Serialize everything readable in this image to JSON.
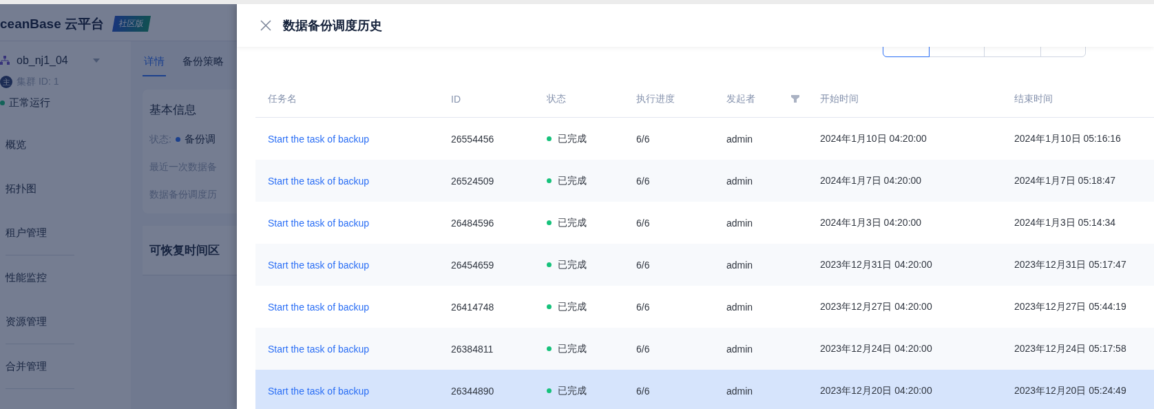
{
  "app": {
    "logo": "ceanBase 云平台",
    "edition_badge": "社区版",
    "cluster": {
      "name": "ob_nj1_04",
      "role_badge": "主",
      "id_label": "集群 ID: 1",
      "status": "正常运行"
    },
    "nav_groups": [
      {
        "items": [
          "概览",
          "拓扑图",
          "租户管理"
        ]
      },
      {
        "items": [
          "性能监控",
          "资源管理"
        ]
      },
      {
        "items": [
          "合并管理"
        ]
      }
    ],
    "tabs": [
      {
        "label": "详情",
        "selected": true
      },
      {
        "label": "备份策略",
        "selected": false
      }
    ],
    "basic_info": {
      "title": "基本信息",
      "status_label": "状态:",
      "status_value": "备份调",
      "rows": [
        "最近一次数据备",
        "数据备份调度历"
      ]
    },
    "recovery_card": {
      "title": "可恢复时间区"
    }
  },
  "drawer": {
    "title": "数据备份调度历史",
    "filters": [
      {
        "selected": true
      },
      {
        "selected": false
      },
      {
        "selected": false
      },
      {
        "selected": false
      }
    ],
    "columns": [
      {
        "label": "任务名"
      },
      {
        "label": "ID"
      },
      {
        "label": "状态"
      },
      {
        "label": "执行进度"
      },
      {
        "label": "发起者",
        "filterable": true
      },
      {
        "label": "开始时间"
      },
      {
        "label": "结束时间"
      }
    ],
    "rows": [
      {
        "task": "Start the task of backup",
        "id": "26554456",
        "status": "已完成",
        "progress": "6/6",
        "initiator": "admin",
        "start": "2024年1月10日 04:20:00",
        "end": "2024年1月10日 05:16:16",
        "selected": false
      },
      {
        "task": "Start the task of backup",
        "id": "26524509",
        "status": "已完成",
        "progress": "6/6",
        "initiator": "admin",
        "start": "2024年1月7日 04:20:00",
        "end": "2024年1月7日 05:18:47",
        "selected": false
      },
      {
        "task": "Start the task of backup",
        "id": "26484596",
        "status": "已完成",
        "progress": "6/6",
        "initiator": "admin",
        "start": "2024年1月3日 04:20:00",
        "end": "2024年1月3日 05:14:34",
        "selected": false
      },
      {
        "task": "Start the task of backup",
        "id": "26454659",
        "status": "已完成",
        "progress": "6/6",
        "initiator": "admin",
        "start": "2023年12月31日 04:20:00",
        "end": "2023年12月31日 05:17:47",
        "selected": false
      },
      {
        "task": "Start the task of backup",
        "id": "26414748",
        "status": "已完成",
        "progress": "6/6",
        "initiator": "admin",
        "start": "2023年12月27日 04:20:00",
        "end": "2023年12月27日 05:44:19",
        "selected": false
      },
      {
        "task": "Start the task of backup",
        "id": "26384811",
        "status": "已完成",
        "progress": "6/6",
        "initiator": "admin",
        "start": "2023年12月24日 04:20:00",
        "end": "2023年12月24日 05:17:58",
        "selected": false
      },
      {
        "task": "Start the task of backup",
        "id": "26344890",
        "status": "已完成",
        "progress": "6/6",
        "initiator": "admin",
        "start": "2023年12月20日 04:20:00",
        "end": "2023年12月20日 05:24:49",
        "selected": true
      }
    ]
  }
}
